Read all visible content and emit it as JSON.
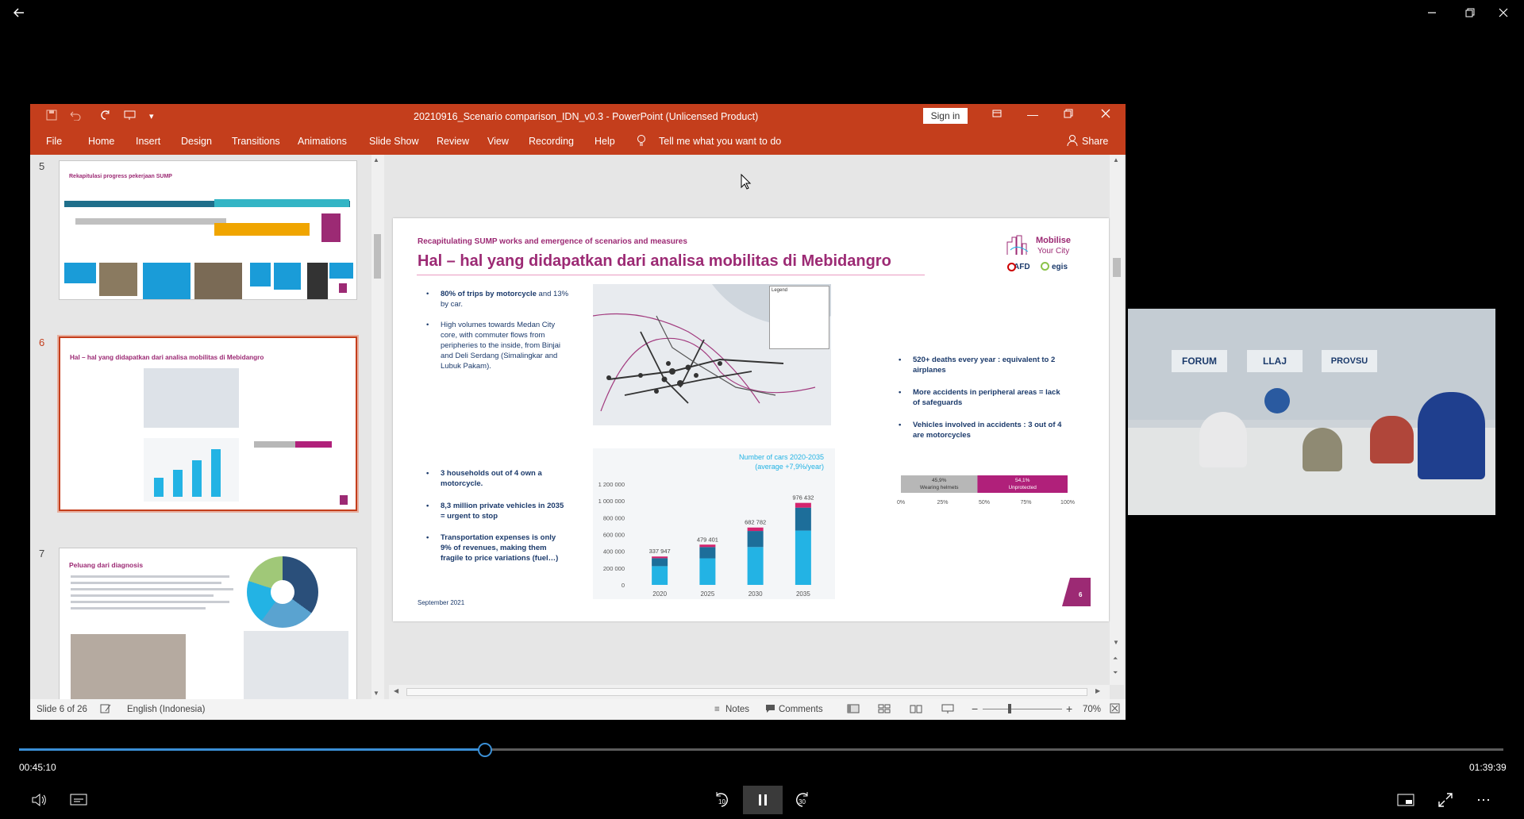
{
  "player": {
    "current_time": "00:45:10",
    "total_time": "01:39:39",
    "progress_fraction": 0.3
  },
  "ppt": {
    "window_title": "20210916_Scenario comparison_IDN_v0.3  -  PowerPoint (Unlicensed Product)",
    "sign_in": "Sign in",
    "menu": [
      "File",
      "Home",
      "Insert",
      "Design",
      "Transitions",
      "Animations",
      "Slide Show",
      "Review",
      "View",
      "Recording",
      "Help"
    ],
    "tell_me": "Tell me what you want to do",
    "share": "Share",
    "status": {
      "slide_of": "Slide 6 of 26",
      "language": "English (Indonesia)",
      "notes": "Notes",
      "comments": "Comments",
      "zoom": "70%"
    }
  },
  "thumbnails": {
    "numbers": [
      "5",
      "6",
      "7"
    ],
    "t5_title": "Rekapitulasi progress pekerjaan SUMP",
    "t6_title": "Hal – hal yang didapatkan dari analisa mobilitas di Mebidangro",
    "t7_title": "Peluang dari diagnosis"
  },
  "slide": {
    "subtitle": "Recapitulating SUMP works and emergence of scenarios and measures",
    "title": "Hal – hal yang didapatkan dari analisa mobilitas di Mebidangro",
    "logo_line1": "Mobilise",
    "logo_line2": "Your City",
    "logo_afd": "AFD",
    "logo_egis": "egis",
    "bullets_top": [
      {
        "bold": "80% of trips by motorcycle",
        "rest": " and 13% by car."
      },
      {
        "bold": "",
        "rest": "High volumes towards Medan City core, with commuter flows from peripheries to the inside, from Binjai and Deli Serdang (Simalingkar and Lubuk Pakam)."
      }
    ],
    "bullets_bottom": [
      "3 households out of 4 own a motorcycle.",
      "8,3 million private vehicles in 2035 = urgent to stop",
      "Transportation expenses is only 9% of revenues, making them fragile to price variations (fuel…)"
    ],
    "bullets_right": [
      "520+ deaths every year : equivalent to 2 airplanes",
      "More accidents in peripheral areas = lack of safeguards",
      "Vehicles involved in accidents : 3 out of 4 are motorcycles"
    ],
    "footer_date": "September 2021",
    "page_num": "6",
    "map_legend": "Legend"
  },
  "chart_data": [
    {
      "type": "bar",
      "title": "Number of cars 2020-2035",
      "subtitle": "(average +7,9%/year)",
      "categories": [
        "2020",
        "2025",
        "2030",
        "2035"
      ],
      "values": [
        337947,
        479401,
        682782,
        976432
      ],
      "value_labels": [
        "337 947",
        "479 401",
        "682 782",
        "976 432"
      ],
      "ylim": [
        0,
        1200000
      ],
      "ytick_labels": [
        "1 200 000",
        "1 000 000",
        "800 000",
        "600 000",
        "400 000",
        "200 000",
        "0"
      ],
      "colors": {
        "light": "#23b3e4",
        "dark": "#1d6e9a",
        "top": "#d4246e"
      }
    },
    {
      "type": "bar",
      "orientation": "horizontal-stacked",
      "segments": [
        {
          "name": "Wearing helmets",
          "value": 45.9,
          "label": "45,9%",
          "color": "#b7b7b7"
        },
        {
          "name": "Unprotected",
          "value": 54.1,
          "label": "54,1%",
          "color": "#b0207a"
        }
      ],
      "xtick_labels": [
        "0%",
        "25%",
        "50%",
        "75%",
        "100%"
      ]
    }
  ],
  "video": {
    "signs": [
      "FORUM",
      "LLAJ",
      "PROVSU"
    ]
  }
}
